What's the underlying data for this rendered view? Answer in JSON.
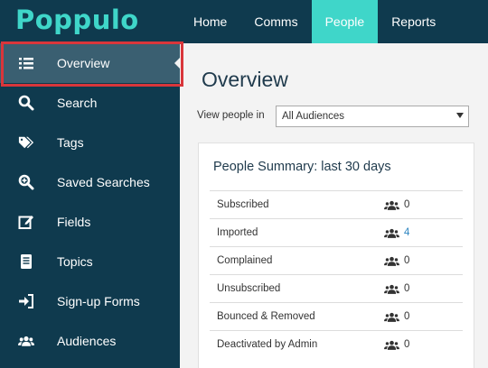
{
  "app": {
    "logo": "Poppulo"
  },
  "topnav": [
    {
      "label": "Home",
      "active": false
    },
    {
      "label": "Comms",
      "active": false
    },
    {
      "label": "People",
      "active": true
    },
    {
      "label": "Reports",
      "active": false
    }
  ],
  "sidebar": [
    {
      "label": "Overview",
      "icon": "list-icon",
      "active": true
    },
    {
      "label": "Search",
      "icon": "search-icon",
      "active": false
    },
    {
      "label": "Tags",
      "icon": "tags-icon",
      "active": false
    },
    {
      "label": "Saved Searches",
      "icon": "search-plus-icon",
      "active": false
    },
    {
      "label": "Fields",
      "icon": "edit-icon",
      "active": false
    },
    {
      "label": "Topics",
      "icon": "document-icon",
      "active": false
    },
    {
      "label": "Sign-up Forms",
      "icon": "sign-in-icon",
      "active": false
    },
    {
      "label": "Audiences",
      "icon": "users-icon",
      "active": false
    }
  ],
  "main": {
    "title": "Overview",
    "view_label": "View people in",
    "audience_select": "All Audiences",
    "summary": {
      "title": "People Summary: last 30 days",
      "rows": [
        {
          "label": "Subscribed",
          "value": "0",
          "link": false
        },
        {
          "label": "Imported",
          "value": "4",
          "link": true
        },
        {
          "label": "Complained",
          "value": "0",
          "link": false
        },
        {
          "label": "Unsubscribed",
          "value": "0",
          "link": false
        },
        {
          "label": "Bounced & Removed",
          "value": "0",
          "link": false
        },
        {
          "label": "Deactivated by Admin",
          "value": "0",
          "link": false
        }
      ]
    }
  },
  "colors": {
    "navy": "#0f3a4e",
    "teal": "#3fd6c9",
    "active_sidebar": "#3a5f71",
    "highlight_border": "#d9363b",
    "link": "#2e86c1"
  }
}
